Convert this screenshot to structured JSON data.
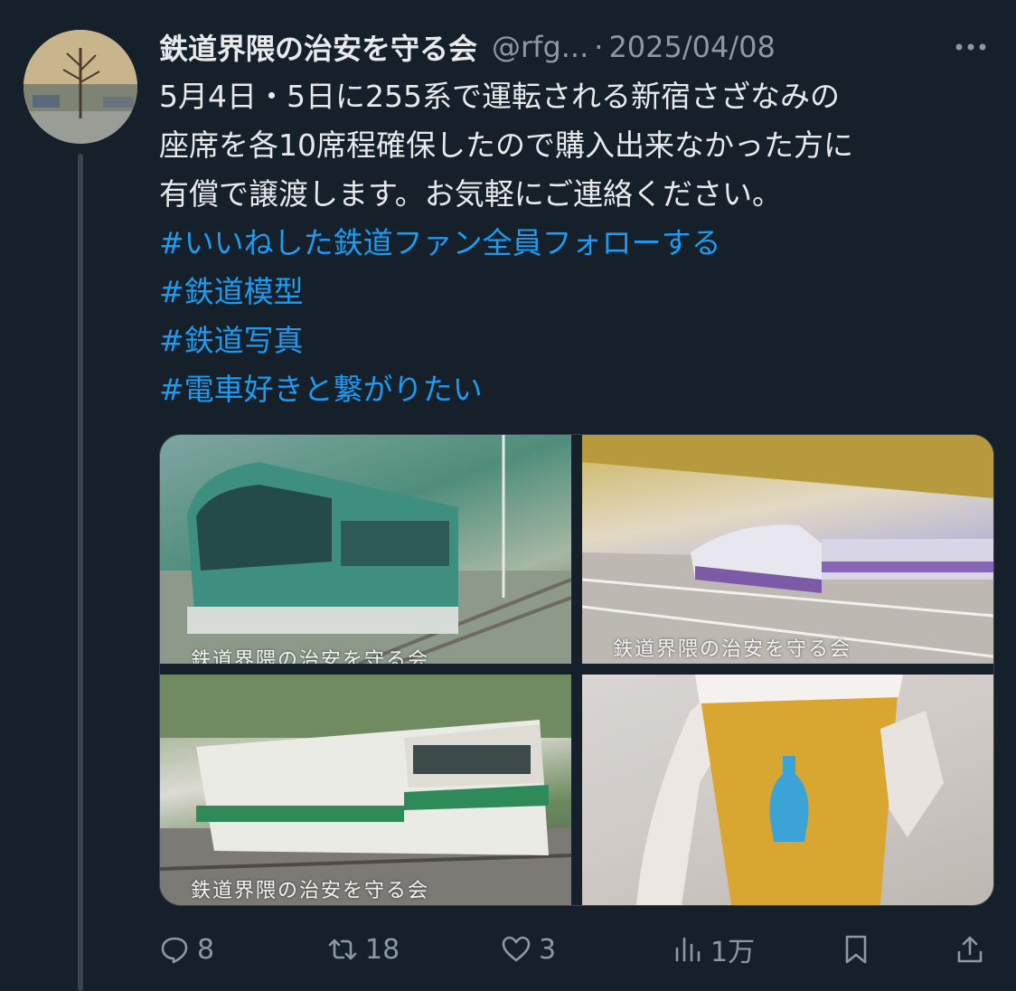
{
  "tweet": {
    "display_name": "鉄道界隈の治安を守る会",
    "handle": "@rfg...",
    "separator": "·",
    "date": "2025/04/08",
    "text_lines": [
      "5月4日・5日に255系で運転される新宿さざなみの",
      "座席を各10席程確保したので購入出来なかった方に",
      "有償で譲渡します。お気軽にご連絡ください。"
    ],
    "hashtags": [
      "#いいねした鉄道ファン全員フォローする",
      "#鉄道模型",
      "#鉄道写真",
      "#電車好きと繋がりたい"
    ]
  },
  "media": {
    "watermark": "鉄道界隈の治安を守る会",
    "watermark_partial": "鉄道界隈の治安を守る会"
  },
  "actions": {
    "replies": "8",
    "retweets": "18",
    "likes": "3",
    "views": "1万"
  },
  "colors": {
    "background": "#15202b",
    "text": "#e7e9ea",
    "secondary": "#8b98a5",
    "hashtag": "#1d9bf0",
    "thread_line": "#38444d"
  },
  "icons": {
    "more": "more-dots-icon",
    "reply": "reply-icon",
    "retweet": "retweet-icon",
    "like": "heart-icon",
    "views": "views-icon",
    "bookmark": "bookmark-icon",
    "share": "share-icon"
  }
}
